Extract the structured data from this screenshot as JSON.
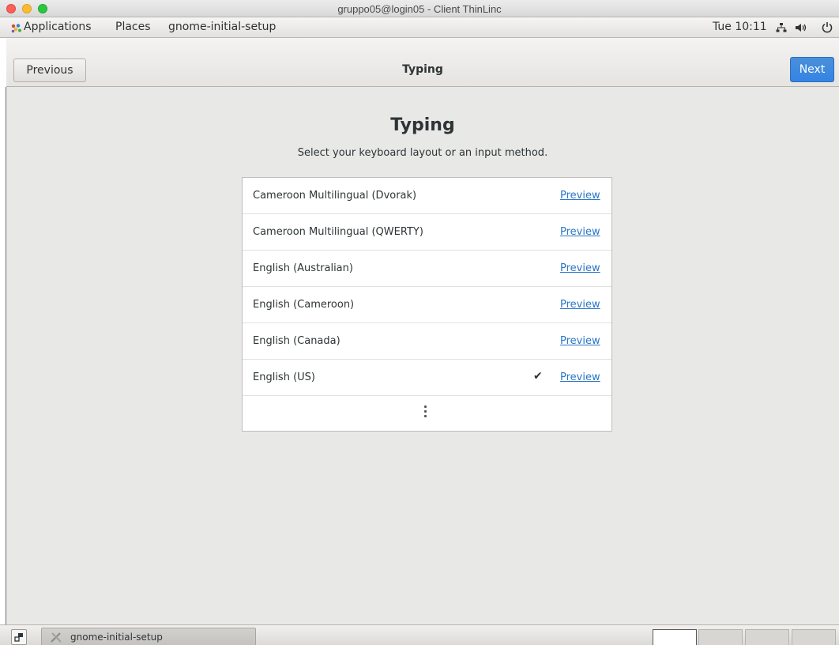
{
  "window": {
    "title": "gruppo05@login05 - Client ThinLinc"
  },
  "top_panel": {
    "applications": "Applications",
    "places": "Places",
    "app_name": "gnome-initial-setup",
    "clock": "Tue 10:11",
    "icons": [
      "network-icon",
      "volume-icon",
      "power-icon"
    ]
  },
  "header": {
    "previous_label": "Previous",
    "title": "Typing",
    "next_label": "Next"
  },
  "main": {
    "heading": "Typing",
    "subtitle": "Select your keyboard layout or an input method.",
    "layouts": [
      {
        "name": "Cameroon Multilingual (Dvorak)",
        "preview": "Preview",
        "selected": false
      },
      {
        "name": "Cameroon Multilingual (QWERTY)",
        "preview": "Preview",
        "selected": false
      },
      {
        "name": "English (Australian)",
        "preview": "Preview",
        "selected": false
      },
      {
        "name": "English (Cameroon)",
        "preview": "Preview",
        "selected": false
      },
      {
        "name": "English (Canada)",
        "preview": "Preview",
        "selected": false
      },
      {
        "name": "English (US)",
        "preview": "Preview",
        "selected": true,
        "check": "✔"
      }
    ]
  },
  "taskbar": {
    "task_label": "gnome-initial-setup",
    "workspaces": 4,
    "active_workspace": 1
  },
  "colors": {
    "accent": "#3584e4",
    "link": "#2a76c6",
    "background": "#e8e8e7"
  }
}
